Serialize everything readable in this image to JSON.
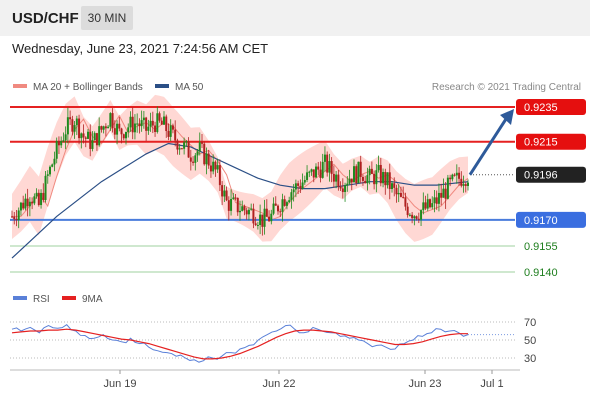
{
  "header": {
    "symbol": "USD/CHF",
    "timeframe": "30 MIN"
  },
  "datetime": "Wednesday, June 23, 2021 7:24:56 AM CET",
  "legend": {
    "bollinger": "MA 20 + Bollinger Bands",
    "ma50": "MA 50",
    "copyright": "Research © 2021 Trading Central"
  },
  "colors": {
    "red": "#e52121",
    "blue": "#4a7cdc",
    "green": "#1e7e1e",
    "candle_up": "#1e8a1e",
    "candle_down": "#b02020",
    "band": "#ffd8d4",
    "ma50": "#2b4f86",
    "arrow": "#2e5a9a"
  },
  "chart_data": [
    {
      "type": "candlestick",
      "instrument": "USD/CHF",
      "timeframe": "30 MIN",
      "x_ticks": [
        "Jun 19",
        "Jun 22",
        "Jun 23",
        "Jul 1"
      ],
      "price_levels": [
        {
          "value": 0.9235,
          "label": "0.9235",
          "style": "resistance",
          "color": "#e52121"
        },
        {
          "value": 0.9215,
          "label": "0.9215",
          "style": "resistance",
          "color": "#e52121"
        },
        {
          "value": 0.9196,
          "label": "0.9196",
          "style": "current",
          "color": "#222222"
        },
        {
          "value": 0.917,
          "label": "0.9170",
          "style": "pivot",
          "color": "#4a7cdc"
        },
        {
          "value": 0.9155,
          "label": "0.9155",
          "style": "support",
          "color": "#1e7e1e"
        },
        {
          "value": 0.914,
          "label": "0.9140",
          "style": "support",
          "color": "#1e7e1e"
        }
      ],
      "forecast_target": 0.9235,
      "close_path": [
        [
          0,
          0.9172
        ],
        [
          4,
          0.9178
        ],
        [
          8,
          0.9185
        ],
        [
          12,
          0.9178
        ],
        [
          16,
          0.9195
        ],
        [
          20,
          0.921
        ],
        [
          24,
          0.9222
        ],
        [
          28,
          0.9228
        ],
        [
          32,
          0.9218
        ],
        [
          36,
          0.9214
        ],
        [
          40,
          0.9222
        ],
        [
          44,
          0.923
        ],
        [
          48,
          0.922
        ],
        [
          52,
          0.9224
        ],
        [
          56,
          0.9226
        ],
        [
          60,
          0.9222
        ],
        [
          64,
          0.9226
        ],
        [
          68,
          0.9224
        ],
        [
          72,
          0.9218
        ],
        [
          76,
          0.9213
        ],
        [
          80,
          0.9208
        ],
        [
          84,
          0.921
        ],
        [
          88,
          0.9204
        ],
        [
          92,
          0.9196
        ],
        [
          96,
          0.918
        ],
        [
          100,
          0.9178
        ],
        [
          104,
          0.9176
        ],
        [
          108,
          0.9174
        ],
        [
          112,
          0.917
        ],
        [
          116,
          0.9172
        ],
        [
          120,
          0.918
        ],
        [
          124,
          0.9186
        ],
        [
          128,
          0.919
        ],
        [
          132,
          0.9194
        ],
        [
          136,
          0.9198
        ],
        [
          140,
          0.9202
        ],
        [
          144,
          0.9196
        ],
        [
          148,
          0.9192
        ],
        [
          152,
          0.9196
        ],
        [
          156,
          0.9198
        ],
        [
          160,
          0.9194
        ],
        [
          164,
          0.9196
        ],
        [
          168,
          0.9192
        ],
        [
          172,
          0.9184
        ],
        [
          176,
          0.9178
        ],
        [
          180,
          0.9174
        ],
        [
          184,
          0.9176
        ],
        [
          188,
          0.9178
        ],
        [
          192,
          0.9184
        ],
        [
          196,
          0.919
        ],
        [
          200,
          0.9194
        ],
        [
          204,
          0.9196
        ]
      ],
      "ma50_path": [
        [
          0,
          0.9148
        ],
        [
          10,
          0.916
        ],
        [
          20,
          0.9172
        ],
        [
          30,
          0.9182
        ],
        [
          40,
          0.9192
        ],
        [
          50,
          0.92
        ],
        [
          60,
          0.9208
        ],
        [
          70,
          0.9214
        ],
        [
          80,
          0.9212
        ],
        [
          90,
          0.9206
        ],
        [
          100,
          0.92
        ],
        [
          110,
          0.9194
        ],
        [
          120,
          0.919
        ],
        [
          130,
          0.9188
        ],
        [
          140,
          0.9188
        ],
        [
          150,
          0.919
        ],
        [
          160,
          0.9192
        ],
        [
          170,
          0.9192
        ],
        [
          180,
          0.919
        ],
        [
          190,
          0.919
        ],
        [
          204,
          0.9192
        ]
      ]
    },
    {
      "type": "line",
      "indicator": "RSI",
      "legend": [
        "RSI",
        "9MA"
      ],
      "y_ticks": [
        70,
        50,
        30
      ],
      "rsi": [
        62,
        60,
        64,
        58,
        66,
        63,
        67,
        60,
        55,
        52,
        56,
        50,
        48,
        52,
        46,
        42,
        38,
        36,
        32,
        30,
        28,
        27,
        30,
        32,
        36,
        40,
        44,
        50,
        56,
        60,
        66,
        62,
        58,
        64,
        60,
        58,
        54,
        52,
        50,
        46,
        44,
        42,
        40,
        46,
        50,
        54,
        58,
        62,
        60,
        58,
        56
      ],
      "rsi_ma": [
        58,
        59,
        60,
        60,
        61,
        61,
        62,
        61,
        59,
        57,
        55,
        53,
        51,
        50,
        48,
        46,
        43,
        40,
        37,
        34,
        31,
        29,
        29,
        30,
        32,
        35,
        39,
        43,
        48,
        53,
        57,
        60,
        61,
        61,
        60,
        59,
        57,
        55,
        53,
        51,
        49,
        47,
        45,
        45,
        46,
        48,
        51,
        54,
        56,
        57,
        57
      ]
    }
  ]
}
